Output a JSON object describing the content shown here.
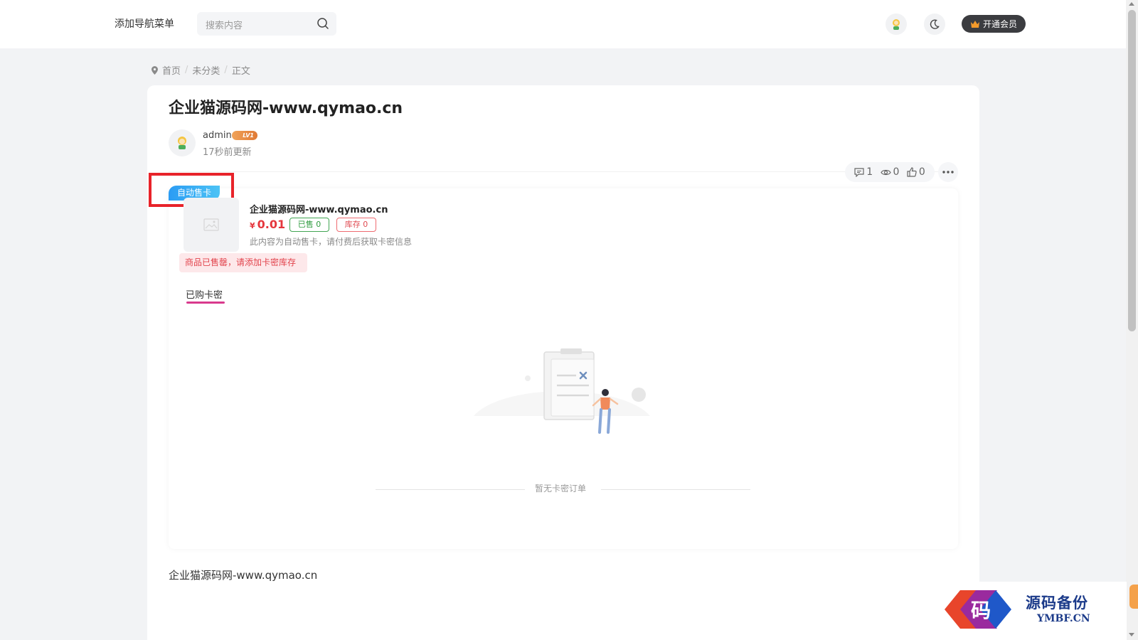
{
  "header": {
    "nav_add": "添加导航菜单",
    "search_placeholder": "搜索内容",
    "vip_label": "开通会员"
  },
  "breadcrumb": {
    "home": "首页",
    "category": "未分类",
    "current": "正文"
  },
  "article": {
    "title": "企业猫源码网-www.qymao.cn",
    "author": "admin",
    "level": "LV1",
    "updated": "17秒前更新",
    "stats": {
      "comments": "1",
      "views": "0",
      "likes": "0"
    },
    "body_text": "企业猫源码网-www.qymao.cn"
  },
  "auto_card": {
    "tag": "自动售卡",
    "product_name": "企业猫源码网-www.qymao.cn",
    "currency": "¥",
    "price": "0.01",
    "sold": "已售 0",
    "stock": "库存 0",
    "description": "此内容为自动售卡，请付费后获取卡密信息",
    "soldout_notice": "商品已售罄，请添加卡密库存",
    "tab_purchased": "已购卡密",
    "empty_text": "暂无卡密订单"
  },
  "watermark": {
    "title": "源码备份",
    "domain": "YMBF.CN",
    "logo_char": "码"
  },
  "colors": {
    "accent_blue": "#2b9cf4",
    "price_red": "#e5373d",
    "sold_green": "#2e9b3f",
    "tab_pink": "#d93a8d",
    "highlight_red": "#e8232a"
  }
}
